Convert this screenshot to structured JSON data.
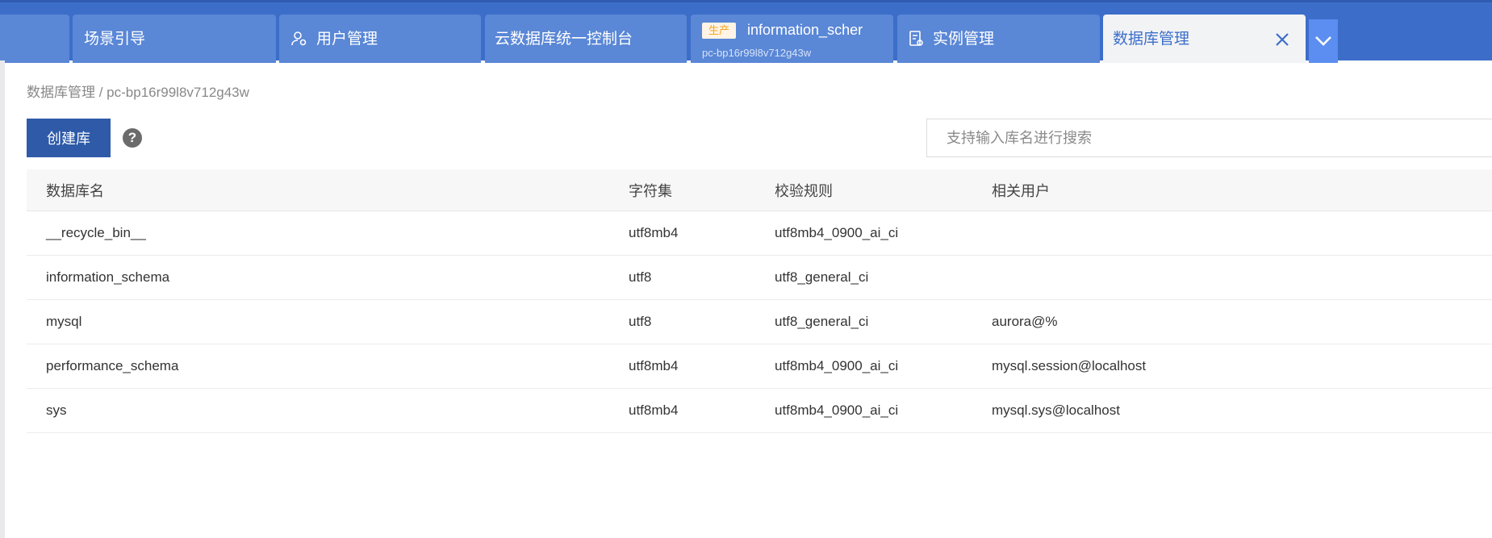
{
  "tabs": [
    {
      "label": "",
      "icon": ""
    },
    {
      "label": "场景引导",
      "icon": ""
    },
    {
      "label": "用户管理",
      "icon": "user-gear-icon"
    },
    {
      "label": "云数据库统一控制台",
      "icon": ""
    },
    {
      "label": "information_scher",
      "badge": "生产",
      "sub": "pc-bp16r99l8v712g43w"
    },
    {
      "label": "实例管理",
      "icon": "database-settings-icon"
    },
    {
      "label": "数据库管理",
      "active": true,
      "close_icon": "close-icon"
    }
  ],
  "tab_more_icon": "chevron-down-icon",
  "breadcrumb": "数据库管理 / pc-bp16r99l8v712g43w",
  "toolbar": {
    "create_label": "创建库",
    "help_icon": "question-circle-icon",
    "help_glyph": "?",
    "search_placeholder": "支持输入库名进行搜索"
  },
  "table": {
    "headers": [
      "数据库名",
      "字符集",
      "校验规则",
      "相关用户"
    ],
    "rows": [
      [
        "__recycle_bin__",
        "utf8mb4",
        "utf8mb4_0900_ai_ci",
        ""
      ],
      [
        "information_schema",
        "utf8",
        "utf8_general_ci",
        ""
      ],
      [
        "mysql",
        "utf8",
        "utf8_general_ci",
        "aurora@%"
      ],
      [
        "performance_schema",
        "utf8mb4",
        "utf8mb4_0900_ai_ci",
        "mysql.session@localhost"
      ],
      [
        "sys",
        "utf8mb4",
        "utf8mb4_0900_ai_ci",
        "mysql.sys@localhost"
      ]
    ]
  },
  "colors": {
    "tabbar": "#3c6ec9",
    "tab": "#5a87d6",
    "active_tab": "#f2f3f5",
    "primary_button": "#2e5aa8",
    "env_badge": "#f5a623"
  }
}
